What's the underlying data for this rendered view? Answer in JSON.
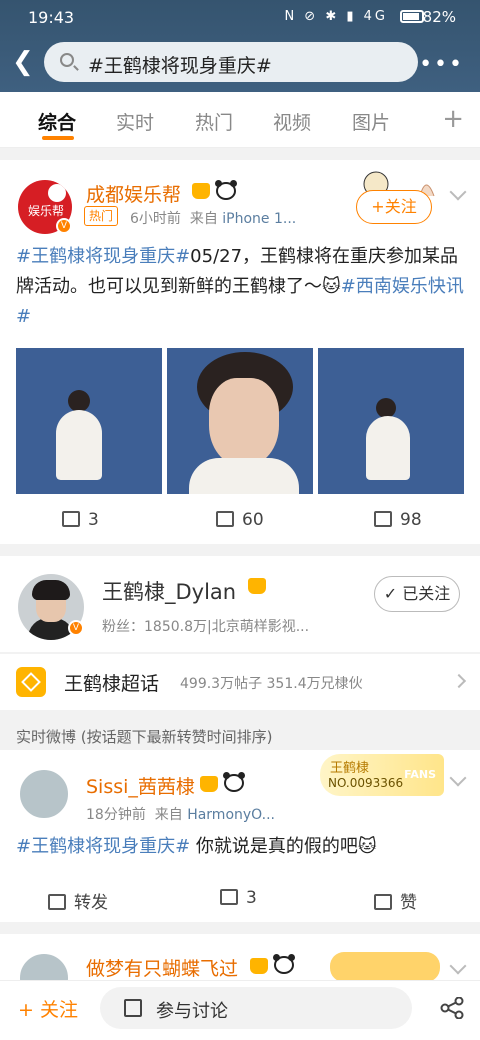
{
  "status": {
    "time": "19:43",
    "icons": "N ⊘ ✱ ▮ 4G",
    "battery": "82%"
  },
  "search": {
    "query": "#王鹤棣将现身重庆#"
  },
  "tabs": [
    "综合",
    "实时",
    "热门",
    "视频",
    "图片"
  ],
  "post1": {
    "author": "成都娱乐帮",
    "avatar_text": "娱乐帮",
    "hot_badge": "热门",
    "time": "6小时前",
    "source_prefix": "来自",
    "source": "iPhone 1...",
    "follow": "+关注",
    "text_tag1": "#王鹤棣将现身重庆#",
    "text_body": "05/27，王鹤棣将在重庆参加某品牌活动。也可以见到新鲜的王鹤棣了～",
    "text_tag2": "#西南娱乐快讯#",
    "repost_count": "3",
    "comment_count": "60",
    "like_count": "98"
  },
  "profile": {
    "name": "王鹤棣_Dylan",
    "fans": "粉丝：1850.8万|北京萌样影视...",
    "following": "已关注"
  },
  "topic": {
    "name": "王鹤棣超话",
    "stats": "499.3万帖子  351.4万兄棣伙"
  },
  "section_label": "实时微博 (按话题下最新转赞时间排序)",
  "post2": {
    "author": "Sissi_茜茜棣",
    "time": "18分钟前",
    "source_prefix": "来自",
    "source": "HarmonyO...",
    "badge_title": "王鹤棣",
    "badge_no": "NO.0093366",
    "badge_fans": "FANS",
    "text_tag": "#王鹤棣将现身重庆#",
    "text_body": " 你就说是真的假的吧",
    "repost": "转发",
    "comment_count": "3",
    "like": "赞"
  },
  "post3": {
    "author": "做梦有只蝴蝶飞过"
  },
  "bottom": {
    "follow": "+ 关注",
    "discuss": "参与讨论"
  },
  "colors": {
    "accent": "#ff8200",
    "link": "#4a7ebb",
    "header": "#3a5a77"
  }
}
